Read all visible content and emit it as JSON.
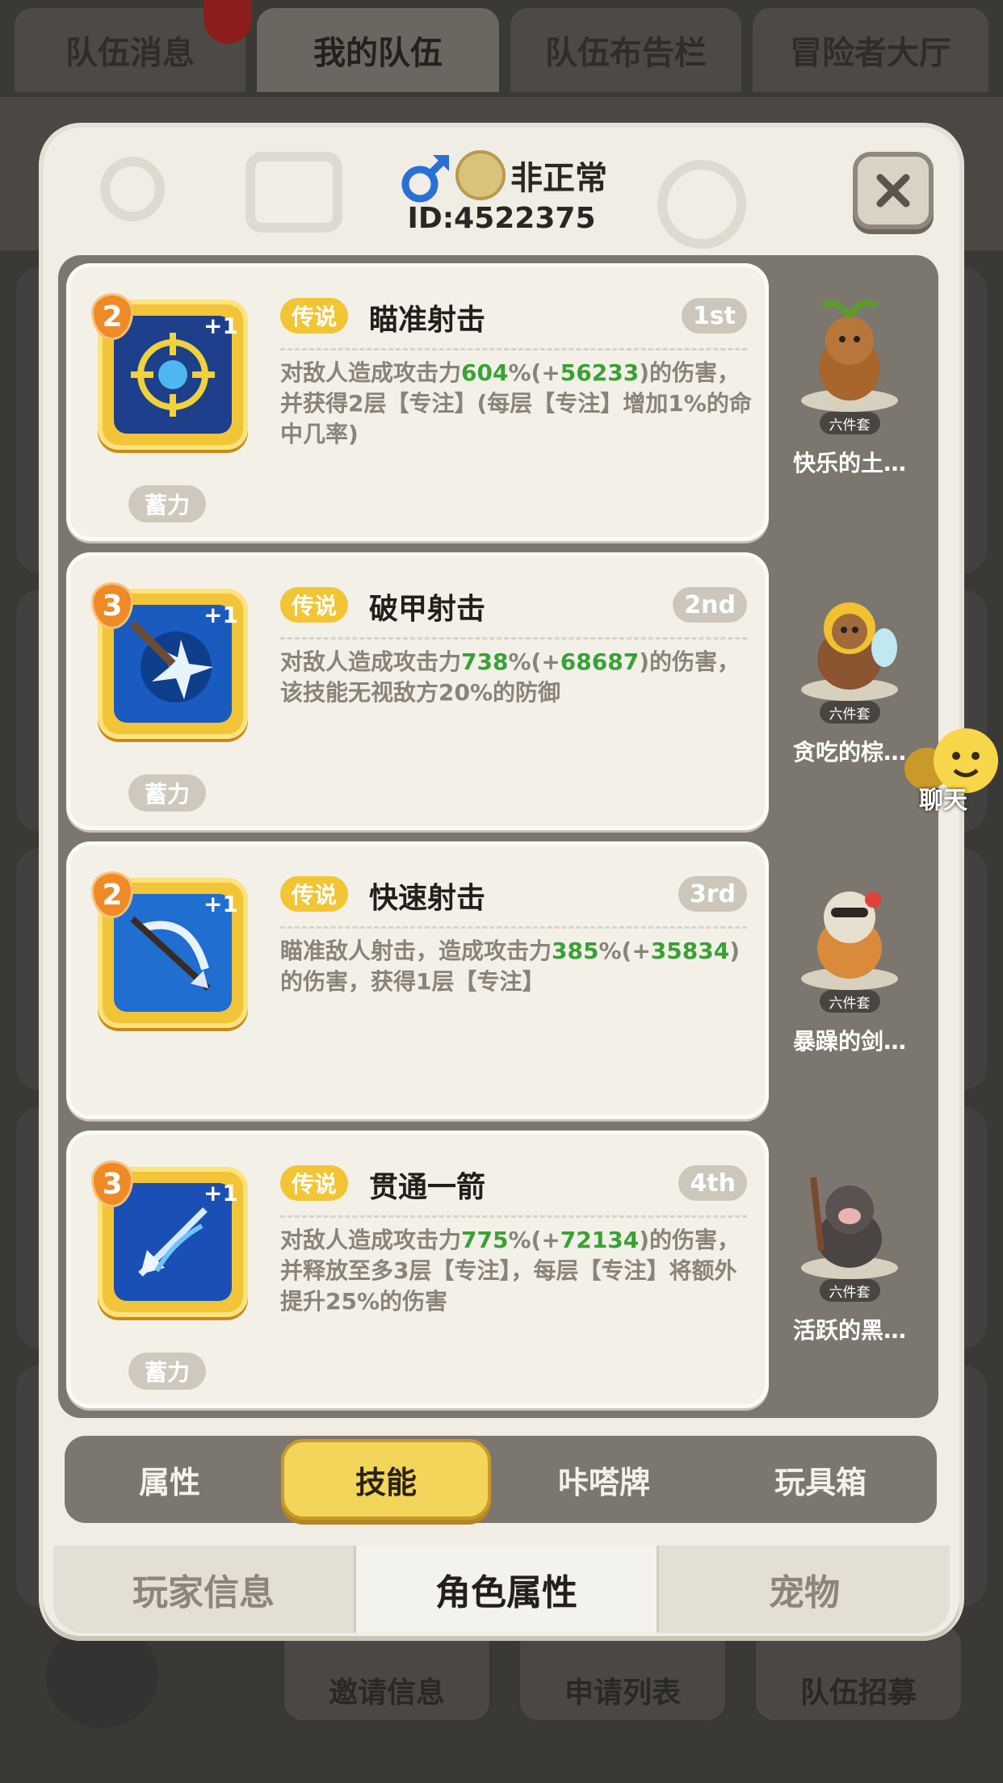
{
  "top_tabs": [
    {
      "label": "队伍消息",
      "active": false
    },
    {
      "label": "我的队伍",
      "active": true
    },
    {
      "label": "队伍布告栏",
      "active": false
    },
    {
      "label": "冒险者大厅",
      "active": false
    }
  ],
  "background_buttons": [
    "邀请信息",
    "申请列表",
    "队伍招募"
  ],
  "player": {
    "gender_icon": "male-icon",
    "name": "非正常",
    "id_text": "ID:4522375"
  },
  "skills": [
    {
      "level": "2",
      "plus": "+1",
      "rarity": "传说",
      "name": "瞄准射击",
      "rank": "1st",
      "desc_parts": [
        "对敌人造成攻击力",
        "604",
        "%(+",
        "56233",
        ")的伤害，并获得2层【专注】(每层【专注】增加1%的命中几率)"
      ],
      "charge": "蓄力",
      "icon": "crosshair-icon",
      "icon_color": "#1d3f8c",
      "pet": {
        "set_tag": "六件套",
        "name": "快乐的土…",
        "color": "#a8652c"
      }
    },
    {
      "level": "3",
      "plus": "+1",
      "rarity": "传说",
      "name": "破甲射击",
      "rank": "2nd",
      "desc_parts": [
        "对敌人造成攻击力",
        "738",
        "%(+",
        "68687",
        ")的伤害，该技能无视敌方20%的防御"
      ],
      "charge": "蓄力",
      "icon": "armor-break-icon",
      "icon_color": "#1a5bbf",
      "pet": {
        "set_tag": "六件套",
        "name": "贪吃的棕…",
        "color": "#8a5530"
      }
    },
    {
      "level": "2",
      "plus": "+1",
      "rarity": "传说",
      "name": "快速射击",
      "rank": "3rd",
      "desc_parts": [
        "瞄准敌人射击，造成攻击力",
        "385",
        "%(+",
        "35834",
        ")的伤害，获得1层【专注】"
      ],
      "charge": "",
      "icon": "bow-arrow-icon",
      "icon_color": "#1f6ed0",
      "pet": {
        "set_tag": "六件套",
        "name": "暴躁的剑…",
        "color": "#d98a3a"
      }
    },
    {
      "level": "3",
      "plus": "+1",
      "rarity": "传说",
      "name": "贯通一箭",
      "rank": "4th",
      "desc_parts": [
        "对敌人造成攻击力",
        "775",
        "%(+",
        "72134",
        ")的伤害，并释放至多3层【专注】，每层【专注】将额外提升25%的伤害"
      ],
      "charge": "蓄力",
      "icon": "piercing-arrow-icon",
      "icon_color": "#1a4fb5",
      "pet": {
        "set_tag": "六件套",
        "name": "活跃的黑…",
        "color": "#4a4442"
      }
    }
  ],
  "chat": {
    "label": "聊天"
  },
  "sub_tabs": [
    {
      "label": "属性",
      "active": false
    },
    {
      "label": "技能",
      "active": true
    },
    {
      "label": "咔嗒牌",
      "active": false
    },
    {
      "label": "玩具箱",
      "active": false
    }
  ],
  "main_tabs": [
    {
      "label": "玩家信息",
      "active": false
    },
    {
      "label": "角色属性",
      "active": true
    },
    {
      "label": "宠物",
      "active": false
    }
  ],
  "colors": {
    "accent_yellow": "#f2c535",
    "highlight_green": "#3aa136",
    "level_orange": "#ef8a27"
  }
}
